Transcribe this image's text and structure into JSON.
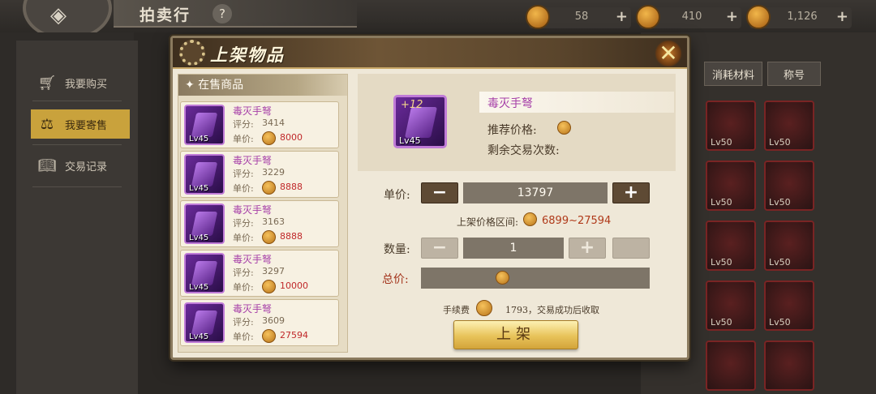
{
  "header": {
    "title": "拍卖行",
    "help": "?",
    "back_icon": "diamond-arrow-icon",
    "resources": [
      {
        "value": "58",
        "plus": "+",
        "icon": "bag-icon"
      },
      {
        "value": "410",
        "plus": "+",
        "icon": "gem-icon"
      },
      {
        "value": "1,126",
        "plus": "+",
        "icon": "coin-icon"
      }
    ]
  },
  "sidebar": {
    "items": [
      {
        "label": "我要购买",
        "icon": "cart-icon"
      },
      {
        "label": "我要寄售",
        "icon": "scale-icon"
      },
      {
        "label": "交易记录",
        "icon": "book-icon"
      }
    ]
  },
  "bg_tabs": {
    "consumables": "消耗材料",
    "title": "称号"
  },
  "bg_slots": {
    "levels": [
      "Lv50",
      "Lv50",
      "Lv50",
      "Lv50",
      "Lv50",
      "Lv50",
      "Lv50",
      "Lv50"
    ]
  },
  "modal": {
    "title": "上架物品",
    "close": "✕",
    "list_header": "✦ 在售商品",
    "listings": [
      {
        "name": "毒灭手弩",
        "score_label": "评分:",
        "score": "3414",
        "price_label": "单价:",
        "price": "8000",
        "level": "Lv45"
      },
      {
        "name": "毒灭手弩",
        "score_label": "评分:",
        "score": "3229",
        "price_label": "单价:",
        "price": "8888",
        "level": "Lv45"
      },
      {
        "name": "毒灭手弩",
        "score_label": "评分:",
        "score": "3163",
        "price_label": "单价:",
        "price": "8888",
        "level": "Lv45"
      },
      {
        "name": "毒灭手弩",
        "score_label": "评分:",
        "score": "3297",
        "price_label": "单价:",
        "price": "10000",
        "level": "Lv45"
      },
      {
        "name": "毒灭手弩",
        "score_label": "评分:",
        "score": "3609",
        "price_label": "单价:",
        "price": "27594",
        "level": "Lv45"
      }
    ],
    "detail": {
      "enhance": "+12",
      "level": "Lv45",
      "name": "毒灭手弩",
      "recommended_price_label": "推荐价格:",
      "remaining_trades_label": "剩余交易次数:"
    },
    "form": {
      "unit_price_label": "单价:",
      "unit_price": "13797",
      "minus": "−",
      "plus": "+",
      "range_label": "上架价格区间:",
      "range": "6899~27594",
      "quantity_label": "数量:",
      "quantity": "1",
      "total_label": "总价:",
      "fee_label": "手续费",
      "fee_text": "1793，交易成功后收取",
      "submit": "上架"
    }
  }
}
